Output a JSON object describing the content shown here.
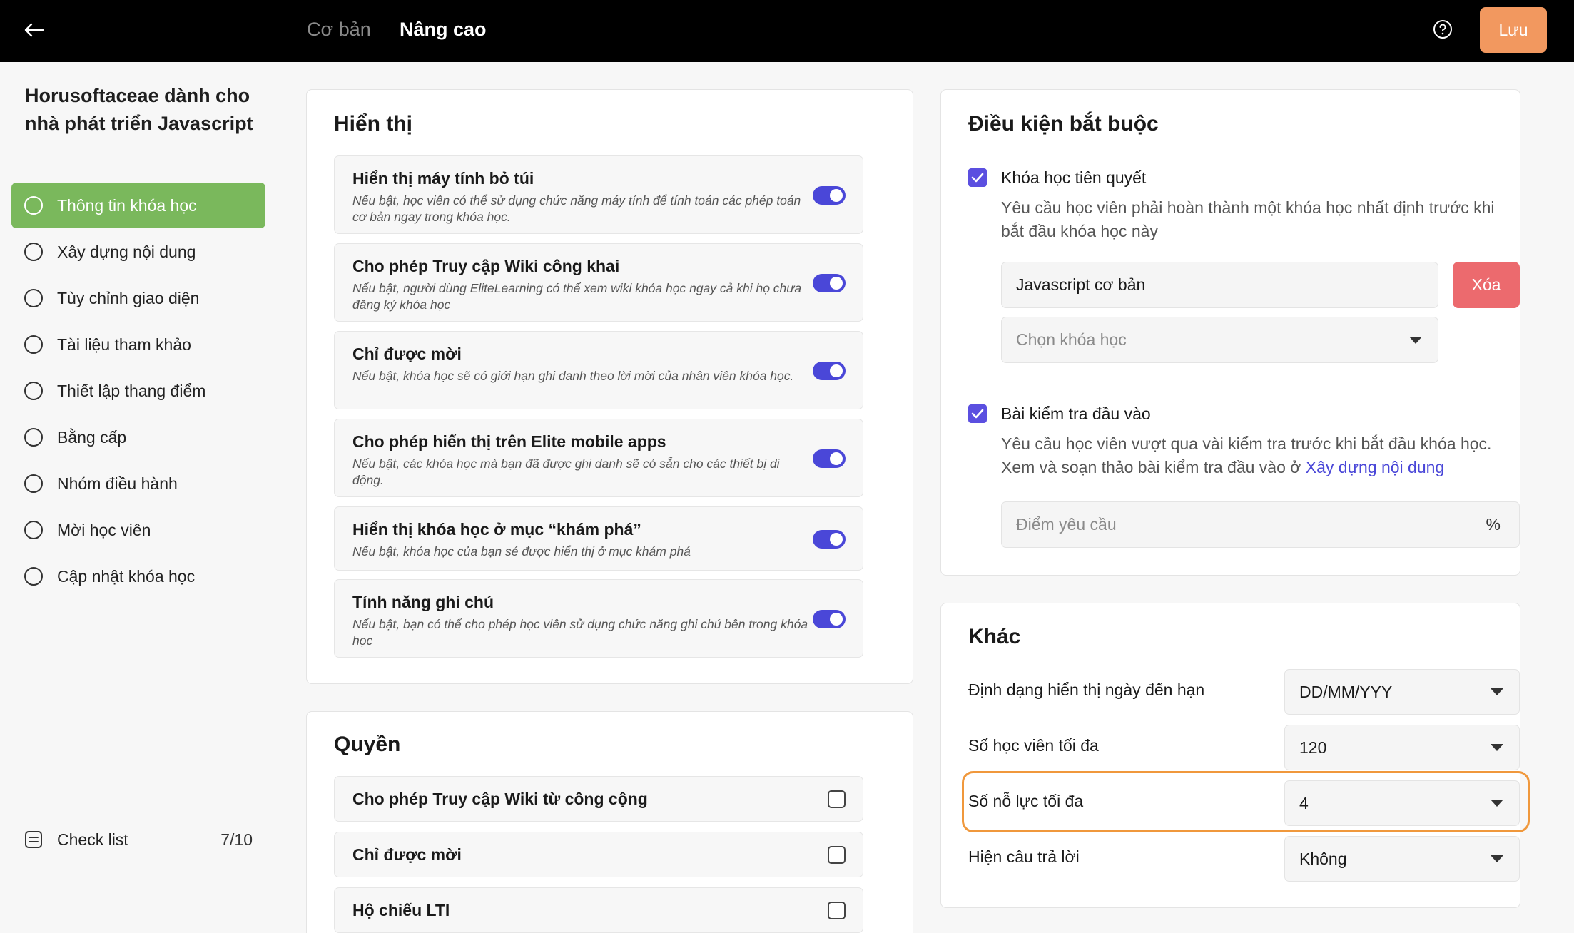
{
  "header": {
    "tabs": [
      "Cơ bản",
      "Nâng cao"
    ],
    "save_label": "Lưu"
  },
  "sidebar": {
    "course_title": "Horusoftaceae dành cho nhà phát triển Javascript",
    "items": [
      {
        "label": "Thông tin khóa học"
      },
      {
        "label": "Xây dựng nội dung"
      },
      {
        "label": "Tùy chỉnh giao diện"
      },
      {
        "label": "Tài liệu tham khảo"
      },
      {
        "label": "Thiết lập thang điểm"
      },
      {
        "label": "Bằng cấp"
      },
      {
        "label": "Nhóm điều hành"
      },
      {
        "label": "Mời học viên"
      },
      {
        "label": "Cập nhật khóa học"
      }
    ],
    "checklist": {
      "label": "Check list",
      "count": "7/10"
    }
  },
  "display": {
    "title": "Hiển thị",
    "rows": [
      {
        "title": "Hiển thị máy tính bỏ túi",
        "desc": "Nếu bật, học viên có thể sử dụng chức năng máy tính để tính toán các phép toán cơ bản ngay trong khóa học."
      },
      {
        "title": "Cho phép Truy cập Wiki công khai",
        "desc": "Nếu bật, người dùng EliteLearning có thể xem wiki khóa học ngay cả khi họ chưa đăng ký khóa học"
      },
      {
        "title": "Chỉ được mời",
        "desc": "Nếu bật, khóa học sẽ có giới hạn ghi danh theo lời mời của nhân viên khóa học."
      },
      {
        "title": "Cho phép hiển thị trên Elite mobile apps",
        "desc": "Nếu bật, các khóa học mà bạn đã được ghi danh sẽ có sẵn cho các thiết bị di động."
      },
      {
        "title": "Hiển thị khóa học ở mục “khám phá”",
        "desc": "Nếu bật, khóa học của bạn sé được hiển thị ở mục khám phá"
      },
      {
        "title": "Tính năng ghi chú",
        "desc": "Nếu bật, bạn có thể cho phép học viên sử dụng chức năng ghi chú bên trong khóa học"
      }
    ]
  },
  "permissions": {
    "title": "Quyền",
    "rows": [
      {
        "label": "Cho phép Truy cập Wiki từ công cộng"
      },
      {
        "label": "Chỉ được mời"
      },
      {
        "label": "Hộ chiếu LTI"
      }
    ]
  },
  "conditions": {
    "title": "Điều kiện bắt buộc",
    "prereq": {
      "label": "Khóa học tiên quyết",
      "desc": "Yêu cầu học viên phải hoàn thành một khóa học nhất định trước khi bắt đầu khóa học này",
      "selected_course": "Javascript cơ bản",
      "delete_label": "Xóa",
      "select_placeholder": "Chọn khóa học"
    },
    "entry_test": {
      "label": "Bài kiểm tra đầu vào",
      "desc": "Yêu cầu học viên vượt qua vài kiểm tra trước khi bắt đầu khóa học. Xem và soạn thảo bài kiểm tra đầu vào ở",
      "link": "Xây dựng nội dung",
      "score_placeholder": "Điểm yêu cầu",
      "score_unit": "%"
    }
  },
  "other": {
    "title": "Khác",
    "rows": [
      {
        "label": "Định dạng hiển thị ngày đến hạn",
        "value": "DD/MM/YYY"
      },
      {
        "label": "Số học viên tối đa",
        "value": "120"
      },
      {
        "label": "Số nỗ lực tối đa",
        "value": "4"
      },
      {
        "label": "Hiện câu trả lời",
        "value": "Không"
      }
    ]
  },
  "colors": {
    "accent": "#4a47d8",
    "active_nav": "#7ab85c",
    "save_button": "#f2985f",
    "delete_button": "#ec6a6e",
    "highlight": "#f0983c"
  }
}
